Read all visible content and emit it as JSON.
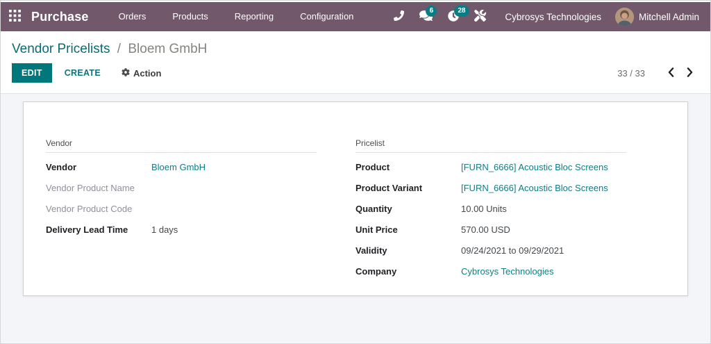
{
  "colors": {
    "navbar_bg": "#71586a",
    "accent_teal": "#00777b",
    "link_teal": "#0e7d84",
    "badge_bg": "#0a7d84",
    "content_bg": "#f4f5f9"
  },
  "navbar": {
    "app_name": "Purchase",
    "menu_items": [
      "Orders",
      "Products",
      "Reporting",
      "Configuration"
    ],
    "messages_badge": "6",
    "activities_badge": "28",
    "company": "Cybrosys Technologies",
    "user": "Mitchell Admin",
    "icons": {
      "apps": "grid-icon",
      "phone": "phone-icon",
      "messages": "chat-bubbles-icon",
      "activities": "clock-icon",
      "tools": "wrench-icon",
      "user": "avatar"
    }
  },
  "breadcrumb": {
    "parent": "Vendor Pricelists",
    "separator": "/",
    "current": "Bloem GmbH"
  },
  "control_panel": {
    "edit_label": "EDIT",
    "create_label": "CREATE",
    "action_label": "Action",
    "action_icon": "gear-icon",
    "pager": {
      "value": "33 / 33",
      "prev_icon": "chevron-left-icon",
      "next_icon": "chevron-right-icon"
    }
  },
  "form": {
    "left": {
      "title": "Vendor",
      "fields": [
        {
          "label": "Vendor",
          "value": "Bloem GmbH",
          "link": true
        },
        {
          "label": "Vendor Product Name",
          "value": "",
          "muted": true
        },
        {
          "label": "Vendor Product Code",
          "value": "",
          "muted": true
        },
        {
          "label": "Delivery Lead Time",
          "value": "1 days"
        }
      ]
    },
    "right": {
      "title": "Pricelist",
      "fields": [
        {
          "label": "Product",
          "value": "[FURN_6666] Acoustic Bloc Screens",
          "link": true
        },
        {
          "label": "Product Variant",
          "value": "[FURN_6666] Acoustic Bloc Screens",
          "link": true
        },
        {
          "label": "Quantity",
          "value": "10.00 Units"
        },
        {
          "label": "Unit Price",
          "value": "570.00 USD"
        },
        {
          "label": "Validity",
          "value": "09/24/2021 to 09/29/2021"
        },
        {
          "label": "Company",
          "value": "Cybrosys Technologies",
          "link": true
        }
      ]
    }
  }
}
